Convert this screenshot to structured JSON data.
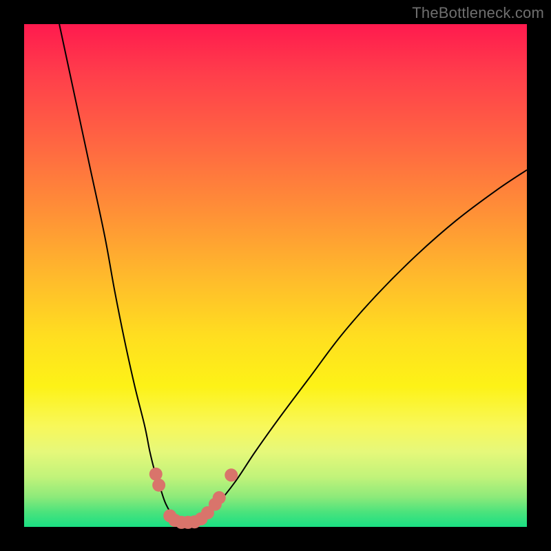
{
  "watermark": "TheBottleneck.com",
  "chart_data": {
    "type": "line",
    "title": "",
    "xlabel": "",
    "ylabel": "",
    "xlim": [
      0,
      100
    ],
    "ylim": [
      0,
      100
    ],
    "series": [
      {
        "name": "left-curve",
        "x": [
          7,
          10,
          13,
          16,
          18,
          20,
          22,
          24,
          25,
          26,
          27,
          28,
          29,
          30
        ],
        "y": [
          100,
          86,
          72,
          58,
          47,
          37,
          28,
          20,
          15,
          11,
          8,
          5,
          3,
          1
        ]
      },
      {
        "name": "right-curve",
        "x": [
          35,
          38,
          42,
          46,
          51,
          57,
          63,
          70,
          78,
          86,
          94,
          100
        ],
        "y": [
          1,
          4,
          9,
          15,
          22,
          30,
          38,
          46,
          54,
          61,
          67,
          71
        ]
      },
      {
        "name": "trough-flat",
        "x": [
          30,
          31,
          32,
          33,
          34,
          35
        ],
        "y": [
          1,
          0.5,
          0.4,
          0.4,
          0.5,
          1
        ]
      }
    ],
    "markers": {
      "name": "highlighted-points",
      "color": "#d9746b",
      "points": [
        {
          "x": 26.2,
          "y": 10.5
        },
        {
          "x": 26.8,
          "y": 8.3
        },
        {
          "x": 29.0,
          "y": 2.2
        },
        {
          "x": 30.0,
          "y": 1.3
        },
        {
          "x": 31.3,
          "y": 0.9
        },
        {
          "x": 32.6,
          "y": 0.9
        },
        {
          "x": 33.9,
          "y": 1.0
        },
        {
          "x": 35.2,
          "y": 1.6
        },
        {
          "x": 36.5,
          "y": 2.8
        },
        {
          "x": 38.0,
          "y": 4.5
        },
        {
          "x": 38.8,
          "y": 5.8
        },
        {
          "x": 41.2,
          "y": 10.3
        }
      ]
    }
  }
}
